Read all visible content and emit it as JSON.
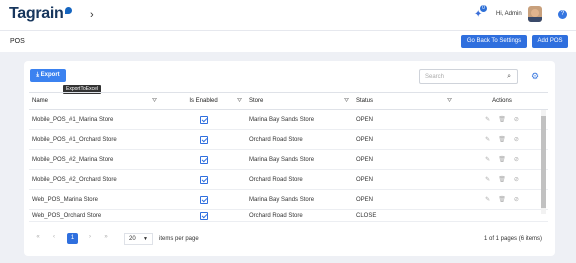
{
  "header": {
    "logo": "Tagrain",
    "notification_count": "0",
    "greeting": "Hi, Admin",
    "help_label": "?"
  },
  "page": {
    "title": "POS",
    "go_back_label": "Go Back To Settings",
    "add_label": "Add POS"
  },
  "toolbar": {
    "export_label": "Export",
    "export_tooltip": "ExportToExcel",
    "search_placeholder": "Search"
  },
  "table": {
    "columns": [
      "Name",
      "Is Enabled",
      "Store",
      "Status",
      "Actions"
    ],
    "rows": [
      {
        "name": "Mobile_POS_#1_Marina Store",
        "enabled": true,
        "store": "Marina Bay Sands Store",
        "status": "OPEN"
      },
      {
        "name": "Mobile_POS_#1_Orchard Store",
        "enabled": true,
        "store": "Orchard Road Store",
        "status": "OPEN"
      },
      {
        "name": "Mobile_POS_#2_Marina Store",
        "enabled": true,
        "store": "Marina Bay Sands Store",
        "status": "OPEN"
      },
      {
        "name": "Mobile_POS_#2_Orchard Store",
        "enabled": true,
        "store": "Orchard Road Store",
        "status": "OPEN"
      },
      {
        "name": "Web_POS_Marina Store",
        "enabled": true,
        "store": "Marina Bay Sands Store",
        "status": "OPEN"
      },
      {
        "name": "Web_POS_Orchard Store",
        "enabled": true,
        "store": "Orchard Road Store",
        "status": "CLOSE"
      }
    ]
  },
  "pager": {
    "current_page": "1",
    "page_size": "20",
    "items_per_page_label": "items per page",
    "info": "1 of 1 pages (6 items)"
  },
  "colors": {
    "primary": "#2f6fde",
    "brand": "#17365d"
  }
}
